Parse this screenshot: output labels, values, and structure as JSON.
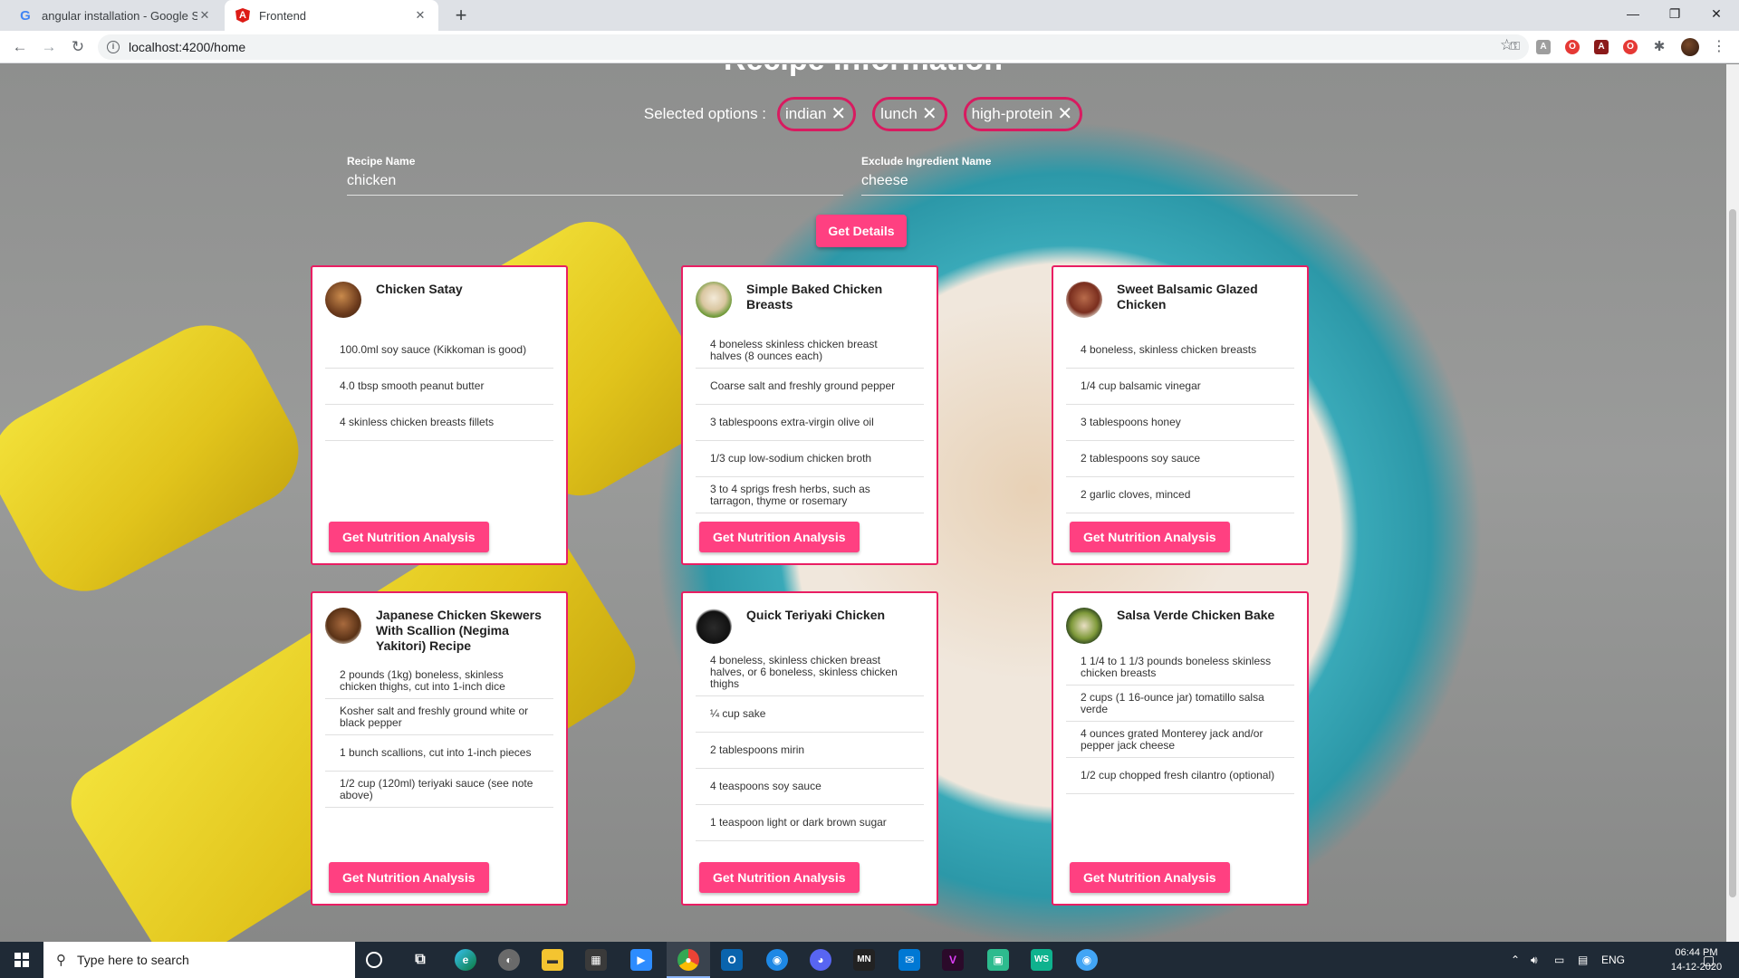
{
  "browser": {
    "tabs": [
      {
        "title": "angular installation - Google Search",
        "icon": "google-icon"
      },
      {
        "title": "Frontend",
        "icon": "angular-icon"
      }
    ],
    "url": "localhost:4200/home"
  },
  "page": {
    "heading": "Recipe Information",
    "selected_label": "Selected options :",
    "chips": [
      "indian",
      "lunch",
      "high-protein"
    ],
    "recipe_name_label": "Recipe Name",
    "recipe_name_value": "chicken",
    "exclude_label": "Exclude Ingredient Name",
    "exclude_value": "cheese",
    "get_details": "Get Details",
    "nutrition_button": "Get Nutrition Analysis"
  },
  "recipes": [
    {
      "title": "Chicken Satay",
      "ingredients": [
        "100.0ml soy sauce (Kikkoman is good)",
        "4.0 tbsp smooth peanut butter",
        "4 skinless chicken breasts fillets"
      ]
    },
    {
      "title": "Simple Baked Chicken Breasts",
      "ingredients": [
        "4 boneless skinless chicken breast halves (8 ounces each)",
        "Coarse salt and freshly ground pepper",
        "3 tablespoons extra-virgin olive oil",
        "1/3 cup low-sodium chicken broth",
        "3 to 4 sprigs fresh herbs, such as tarragon, thyme or rosemary"
      ]
    },
    {
      "title": "Sweet Balsamic Glazed Chicken",
      "ingredients": [
        "4 boneless, skinless chicken breasts",
        "1/4 cup balsamic vinegar",
        "3 tablespoons honey",
        "2 tablespoons soy sauce",
        "2 garlic cloves, minced"
      ]
    },
    {
      "title": "Japanese Chicken Skewers With Scallion (Negima Yakitori) Recipe",
      "ingredients": [
        "2 pounds (1kg) boneless, skinless chicken thighs, cut into 1-inch dice",
        "Kosher salt and freshly ground white or black pepper",
        "1 bunch scallions, cut into 1-inch pieces",
        "1/2 cup (120ml) teriyaki sauce (see note above)"
      ]
    },
    {
      "title": "Quick Teriyaki Chicken",
      "ingredients": [
        "4 boneless, skinless chicken breast halves, or 6 boneless, skinless chicken thighs",
        "¼ cup sake",
        "2 tablespoons mirin",
        "4 teaspoons soy sauce",
        "1 teaspoon light or dark brown sugar"
      ]
    },
    {
      "title": "Salsa Verde Chicken Bake",
      "ingredients": [
        "1 1/4 to 1 1/3 pounds boneless skinless chicken breasts",
        "2 cups (1 16-ounce jar) tomatillo salsa verde",
        "4 ounces grated Monterey jack and/or pepper jack cheese",
        "1/2 cup chopped fresh cilantro (optional)"
      ]
    }
  ],
  "taskbar": {
    "search_placeholder": "Type here to search",
    "language": "ENG",
    "time": "06:44 PM",
    "date": "14-12-2020"
  },
  "colors": {
    "accent": "#ff4081",
    "card_border": "#e91e63",
    "chip_border": "#d81b60"
  }
}
